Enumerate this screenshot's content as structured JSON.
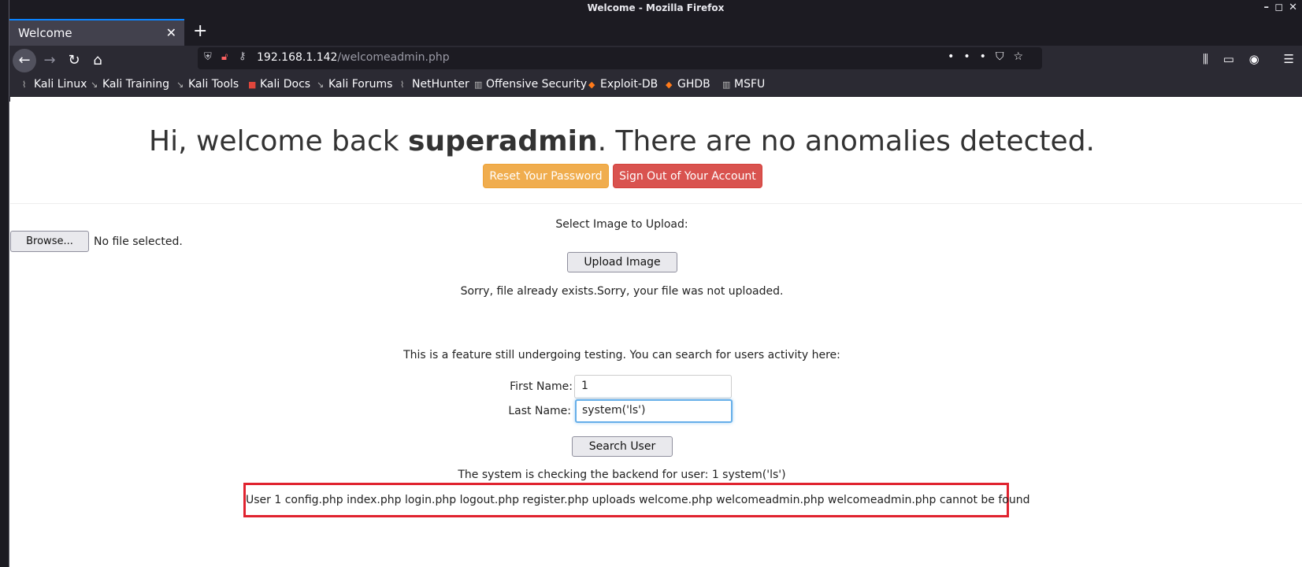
{
  "window": {
    "title": "Welcome - Mozilla Firefox",
    "controls": [
      "–",
      "◻",
      "✕"
    ]
  },
  "tabs": [
    {
      "label": "Welcome",
      "active": true
    }
  ],
  "newtab_label": "+",
  "urlbar": {
    "host": "192.168.1.142",
    "path": "/welcomeadmin.php",
    "actions": [
      "•••",
      "⛉",
      "☆"
    ]
  },
  "nav": {
    "back": "←",
    "forward": "→",
    "reload": "↻",
    "home": "⌂"
  },
  "toolbar_icons": [
    "⫼",
    "▭",
    "◉",
    "☰"
  ],
  "bookmarks": [
    {
      "label": "Kali Linux",
      "icon": "⌇"
    },
    {
      "label": "Kali Training",
      "icon": "↘"
    },
    {
      "label": "Kali Tools",
      "icon": "↘"
    },
    {
      "label": "Kali Docs",
      "icon": "■"
    },
    {
      "label": "Kali Forums",
      "icon": "↘"
    },
    {
      "label": "NetHunter",
      "icon": "⌇"
    },
    {
      "label": "Offensive Security",
      "icon": "▥"
    },
    {
      "label": "Exploit-DB",
      "icon": "◆"
    },
    {
      "label": "GHDB",
      "icon": "◆"
    },
    {
      "label": "MSFU",
      "icon": "▥"
    }
  ],
  "page": {
    "welcome_prefix": "Hi, welcome back ",
    "welcome_user": "superadmin",
    "welcome_suffix": ". There are no anomalies detected.",
    "reset_button": "Reset Your Password",
    "signout_button": "Sign Out of Your Account",
    "upload": {
      "heading": "Select Image to Upload:",
      "browse_button": "Browse...",
      "no_file": "No file selected.",
      "upload_button": "Upload Image",
      "message": "Sorry, file already exists.Sorry, your file was not uploaded."
    },
    "search": {
      "intro": "This is a feature still undergoing testing. You can search for users activity here:",
      "first_name_label": "First Name:",
      "first_name_value": "1",
      "last_name_label": "Last Name:",
      "last_name_value": "system('ls')",
      "button": "Search User",
      "checking": "The system is checking the backend for user: 1 system('ls')",
      "result": "User 1 config.php index.php login.php logout.php register.php uploads welcome.php welcomeadmin.php welcomeadmin.php cannot be found"
    }
  }
}
